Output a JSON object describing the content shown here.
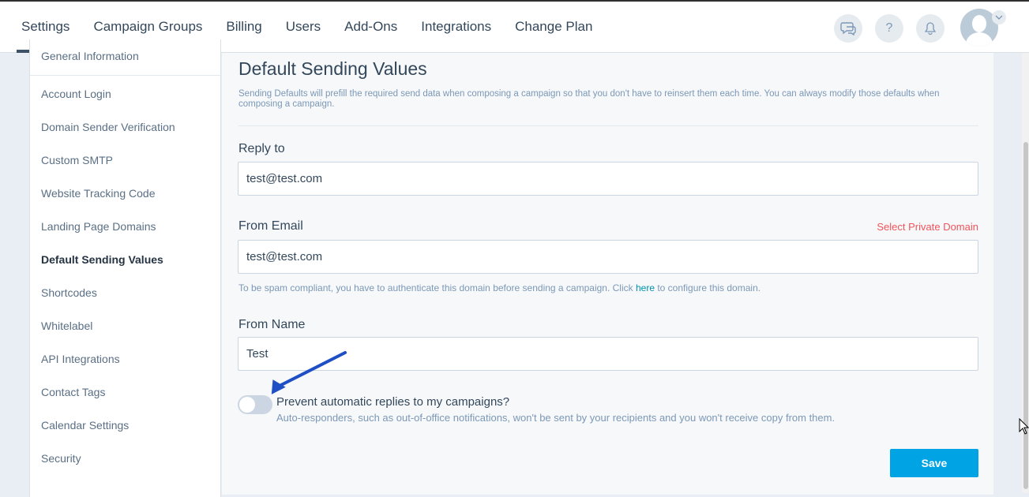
{
  "nav": {
    "items": [
      {
        "label": "Settings"
      },
      {
        "label": "Campaign Groups"
      },
      {
        "label": "Billing"
      },
      {
        "label": "Users"
      },
      {
        "label": "Add-Ons"
      },
      {
        "label": "Integrations"
      },
      {
        "label": "Change Plan"
      }
    ],
    "active": "Settings",
    "icons": [
      "chat-icon",
      "help-icon",
      "bell-icon",
      "avatar",
      "chevron-down-icon"
    ],
    "help_glyph": "?"
  },
  "sidebar": {
    "items": [
      {
        "label": "General Information"
      },
      {
        "label": "Account Login"
      },
      {
        "label": "Domain Sender Verification"
      },
      {
        "label": "Custom SMTP"
      },
      {
        "label": "Website Tracking Code"
      },
      {
        "label": "Landing Page Domains"
      },
      {
        "label": "Default Sending Values"
      },
      {
        "label": "Shortcodes"
      },
      {
        "label": "Whitelabel"
      },
      {
        "label": "API Integrations"
      },
      {
        "label": "Contact Tags"
      },
      {
        "label": "Calendar Settings"
      },
      {
        "label": "Security"
      }
    ],
    "active": "Default Sending Values"
  },
  "page": {
    "title": "Default Sending Values",
    "description": "Sending Defaults will prefill the required send data when composing a campaign so that you don't have to reinsert them each time. You can always modify those defaults when composing a campaign."
  },
  "form": {
    "reply_to": {
      "label": "Reply to",
      "value": "test@test.com"
    },
    "from_email": {
      "label": "From Email",
      "value": "test@test.com",
      "link": "Select Private Domain"
    },
    "help": {
      "before": "To be spam compliant, you have to authenticate this domain before sending a campaign. Click ",
      "link": "here",
      "after": " to configure this domain."
    },
    "from_name": {
      "label": "From Name",
      "value": "Test"
    },
    "toggle": {
      "label": "Prevent automatic replies to my campaigns?",
      "description": "Auto-responders, such as out-of-office notifications, won't be sent by your recipients and you won't receive copy from them.",
      "checked": false
    },
    "save_label": "Save"
  },
  "colors": {
    "accent": "#00a4e4",
    "link_red": "#f2545b",
    "annotation_arrow": "#1f4fc4"
  }
}
